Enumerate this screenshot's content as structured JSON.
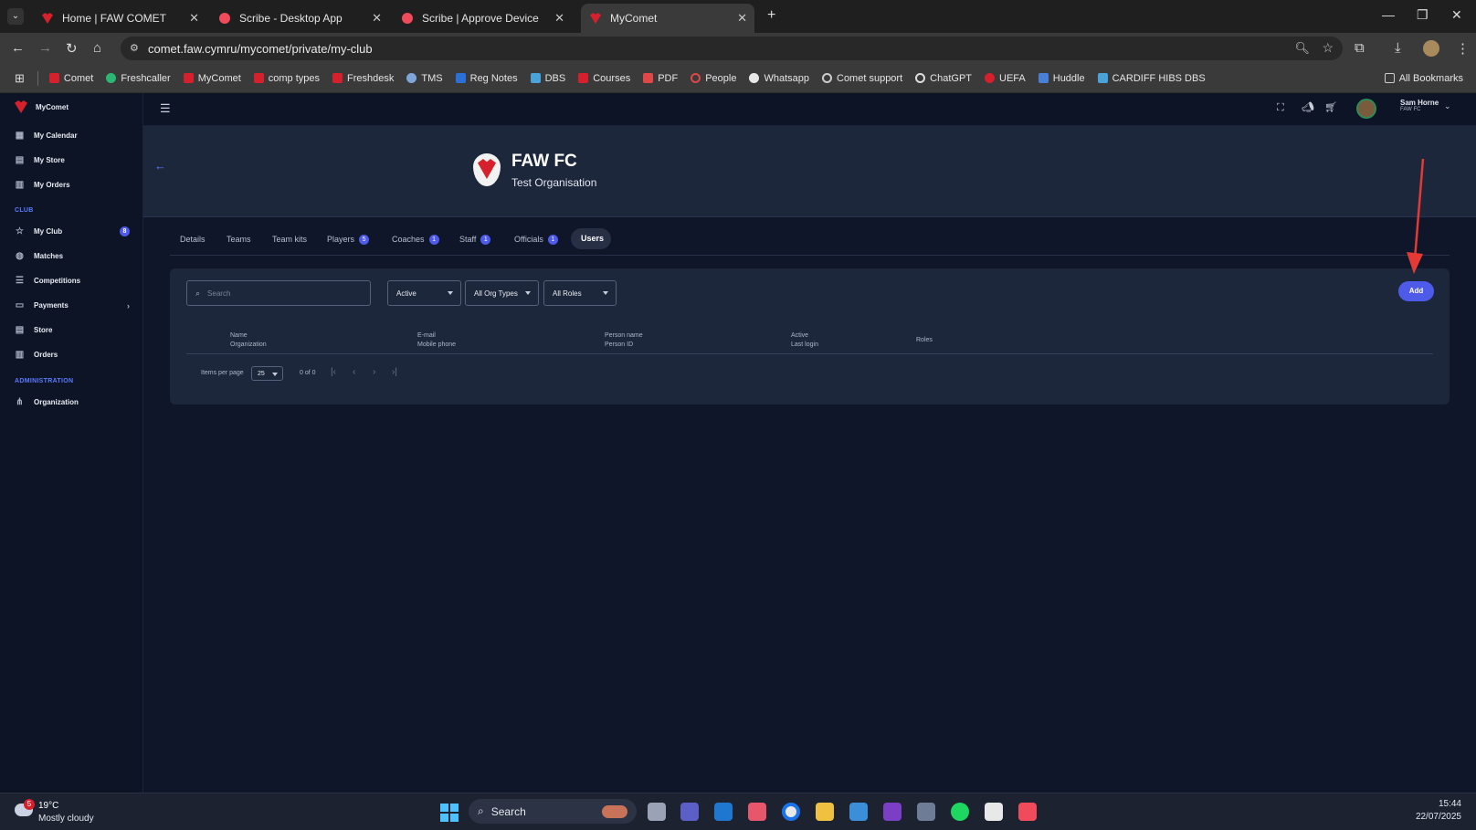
{
  "browser": {
    "tabs": [
      {
        "title": "Home | FAW COMET",
        "active": false
      },
      {
        "title": "Scribe - Desktop App",
        "active": false
      },
      {
        "title": "Scribe | Approve Device",
        "active": false
      },
      {
        "title": "MyComet",
        "active": true
      }
    ],
    "url": "comet.faw.cymru/mycomet/private/my-club",
    "bookmarks": [
      "Comet",
      "Freshcaller",
      "MyComet",
      "comp types",
      "Freshdesk",
      "TMS",
      "Reg Notes",
      "DBS",
      "Courses",
      "PDF",
      "People",
      "Whatsapp",
      "Comet support",
      "ChatGPT",
      "UEFA",
      "Huddle",
      "CARDIFF HIBS DBS"
    ],
    "all_bookmarks": "All Bookmarks"
  },
  "app": {
    "brand": "MyComet",
    "sidebar": {
      "top_items": [
        "My Calendar",
        "My Store",
        "My Orders"
      ],
      "club_label": "CLUB",
      "club_items": [
        {
          "label": "My Club",
          "badge": "8"
        },
        {
          "label": "Matches"
        },
        {
          "label": "Competitions"
        },
        {
          "label": "Payments"
        },
        {
          "label": "Store"
        },
        {
          "label": "Orders"
        }
      ],
      "admin_label": "ADMINISTRATION",
      "admin_items": [
        "Organization"
      ]
    },
    "user": {
      "name": "Sam Horne",
      "org": "FAW FC"
    },
    "header": {
      "title": "FAW FC",
      "subtitle": "Test Organisation"
    },
    "tabs": [
      {
        "label": "Details"
      },
      {
        "label": "Teams"
      },
      {
        "label": "Team kits"
      },
      {
        "label": "Players",
        "badge": "5"
      },
      {
        "label": "Coaches",
        "badge": "1"
      },
      {
        "label": "Staff",
        "badge": "1"
      },
      {
        "label": "Officials",
        "badge": "1"
      },
      {
        "label": "Users",
        "active": true
      }
    ],
    "filters": {
      "search_placeholder": "Search",
      "status": "Active",
      "org_types": "All Org Types",
      "roles": "All Roles"
    },
    "add_button": "Add",
    "table_headers": [
      {
        "line1": "Name",
        "line2": "Organization"
      },
      {
        "line1": "E-mail",
        "line2": "Mobile phone"
      },
      {
        "line1": "Person name",
        "line2": "Person ID"
      },
      {
        "line1": "Active",
        "line2": "Last login"
      },
      {
        "line1": "Roles",
        "line2": ""
      }
    ],
    "pagination": {
      "items_per_page_label": "Items per page",
      "page_size": "25",
      "range": "0 of 0"
    }
  },
  "taskbar": {
    "weather_temp": "19°C",
    "weather_desc": "Mostly cloudy",
    "weather_badge": "5",
    "search_label": "Search",
    "time": "15:44",
    "date": "22/07/2025"
  },
  "colors": {
    "accent": "#4e5ae8",
    "brand_red": "#d6202c",
    "arrow": "#e53935"
  }
}
